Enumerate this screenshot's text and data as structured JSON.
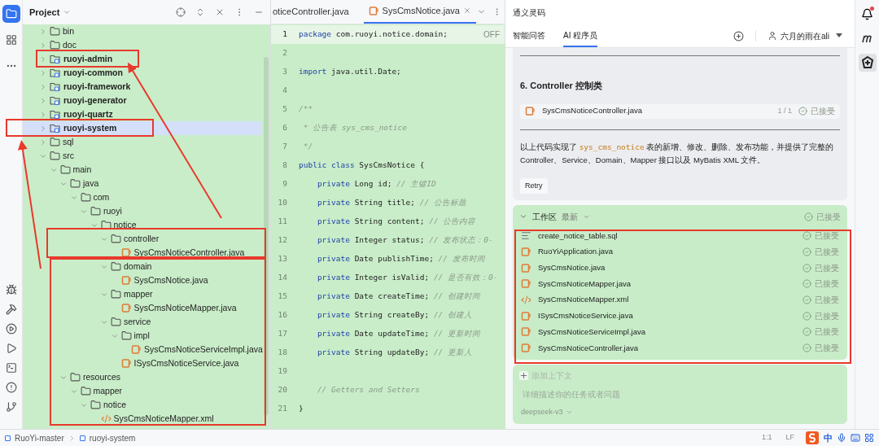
{
  "left_toolbar": {
    "tools": [
      {
        "selected": true
      },
      {
        "selected": false
      },
      {
        "selected": false
      }
    ]
  },
  "project": {
    "title": "Project",
    "tree": [
      {
        "name": "bin",
        "kind": "folder",
        "expanded": false,
        "selected": false
      },
      {
        "name": "doc",
        "kind": "folder",
        "expanded": false,
        "selected": false
      },
      {
        "name": "ruoyi-admin",
        "kind": "module",
        "expanded": false,
        "selected": false
      },
      {
        "name": "ruoyi-common",
        "kind": "module",
        "expanded": false,
        "selected": false
      },
      {
        "name": "ruoyi-framework",
        "kind": "module",
        "expanded": false,
        "selected": false
      },
      {
        "name": "ruoyi-generator",
        "kind": "module",
        "expanded": false,
        "selected": false
      },
      {
        "name": "ruoyi-quartz",
        "kind": "module",
        "expanded": false,
        "selected": false
      },
      {
        "name": "ruoyi-system",
        "kind": "module",
        "expanded": false,
        "selected": true
      },
      {
        "name": "sql",
        "kind": "folder",
        "expanded": false,
        "selected": false
      },
      {
        "name": "src",
        "kind": "folder",
        "expanded": true,
        "selected": false,
        "children": [
          {
            "name": "main",
            "kind": "folder",
            "expanded": true,
            "selected": false,
            "children": [
              {
                "name": "java",
                "kind": "folder",
                "expanded": true,
                "selected": false,
                "children": [
                  {
                    "name": "com",
                    "kind": "folder",
                    "expanded": true,
                    "selected": false,
                    "children": [
                      {
                        "name": "ruoyi",
                        "kind": "folder",
                        "expanded": true,
                        "selected": false,
                        "children": [
                          {
                            "name": "notice",
                            "kind": "folder",
                            "expanded": true,
                            "selected": false,
                            "children": [
                              {
                                "name": "controller",
                                "kind": "folder",
                                "expanded": true,
                                "selected": false,
                                "children": [
                                  {
                                    "name": "SysCmsNoticeController.java",
                                    "kind": "java",
                                    "selected": false
                                  }
                                ]
                              },
                              {
                                "name": "domain",
                                "kind": "folder",
                                "expanded": true,
                                "selected": false,
                                "children": [
                                  {
                                    "name": "SysCmsNotice.java",
                                    "kind": "java",
                                    "selected": false
                                  }
                                ]
                              },
                              {
                                "name": "mapper",
                                "kind": "folder",
                                "expanded": true,
                                "selected": false,
                                "children": [
                                  {
                                    "name": "SysCmsNoticeMapper.java",
                                    "kind": "java",
                                    "selected": false
                                  }
                                ]
                              },
                              {
                                "name": "service",
                                "kind": "folder",
                                "expanded": true,
                                "selected": false,
                                "children": [
                                  {
                                    "name": "impl",
                                    "kind": "folder",
                                    "expanded": true,
                                    "selected": false,
                                    "children": [
                                      {
                                        "name": "SysCmsNoticeServiceImpl.java",
                                        "kind": "java",
                                        "selected": false
                                      }
                                    ]
                                  },
                                  {
                                    "name": "ISysCmsNoticeService.java",
                                    "kind": "java",
                                    "selected": false
                                  }
                                ]
                              }
                            ]
                          }
                        ]
                      }
                    ]
                  }
                ]
              },
              {
                "name": "resources",
                "kind": "folder",
                "expanded": true,
                "selected": false,
                "children": [
                  {
                    "name": "mapper",
                    "kind": "folder",
                    "expanded": true,
                    "selected": false,
                    "children": [
                      {
                        "name": "notice",
                        "kind": "folder",
                        "expanded": true,
                        "selected": false,
                        "children": [
                          {
                            "name": "SysCmsNoticeMapper.xml",
                            "kind": "xml",
                            "selected": false
                          }
                        ]
                      }
                    ]
                  }
                ]
              }
            ]
          }
        ]
      }
    ]
  },
  "editor": {
    "tabs": [
      {
        "label": "oticeController.java",
        "kind": "plain",
        "selected": false
      },
      {
        "label": "SysCmsNotice.java",
        "kind": "java",
        "selected": true
      }
    ],
    "inspection": "OFF",
    "lines": [
      {
        "number": "1",
        "current": true,
        "tokens": [
          {
            "kind": "keyword",
            "text": "package"
          },
          {
            "kind": "plain",
            "text": " com.ruoyi.notice.domain;"
          }
        ]
      },
      {
        "number": "2",
        "current": false
      },
      {
        "number": "3",
        "current": false,
        "tokens": [
          {
            "kind": "keyword",
            "text": "import"
          },
          {
            "kind": "plain",
            "text": " java.util.Date;"
          }
        ]
      },
      {
        "number": "4",
        "current": false
      },
      {
        "number": "5",
        "current": false,
        "tokens": [
          {
            "kind": "comment",
            "text": "/**"
          }
        ]
      },
      {
        "number": "6",
        "current": false,
        "tokens": [
          {
            "kind": "comment",
            "text": " * 公告表 sys_cms_notice"
          }
        ]
      },
      {
        "number": "7",
        "current": false,
        "tokens": [
          {
            "kind": "comment",
            "text": " */"
          }
        ]
      },
      {
        "number": "8",
        "current": false,
        "tokens": [
          {
            "kind": "keyword",
            "text": "public class"
          },
          {
            "kind": "plain",
            "text": " SysCmsNotice {"
          }
        ]
      },
      {
        "number": "9",
        "current": false,
        "tokens": [
          {
            "kind": "keyword",
            "text": "    private"
          },
          {
            "kind": "plain",
            "text": " Long id; "
          },
          {
            "kind": "comment",
            "text": "// 主键ID"
          }
        ]
      },
      {
        "number": "10",
        "current": false,
        "tokens": [
          {
            "kind": "keyword",
            "text": "    private"
          },
          {
            "kind": "plain",
            "text": " String title; "
          },
          {
            "kind": "comment",
            "text": "// 公告标题"
          }
        ]
      },
      {
        "number": "11",
        "current": false,
        "tokens": [
          {
            "kind": "keyword",
            "text": "    private"
          },
          {
            "kind": "plain",
            "text": " String content; "
          },
          {
            "kind": "comment",
            "text": "// 公告内容"
          }
        ]
      },
      {
        "number": "12",
        "current": false,
        "tokens": [
          {
            "kind": "keyword",
            "text": "    private"
          },
          {
            "kind": "plain",
            "text": " Integer status; "
          },
          {
            "kind": "comment",
            "text": "// 发布状态：0-"
          }
        ]
      },
      {
        "number": "13",
        "current": false,
        "tokens": [
          {
            "kind": "keyword",
            "text": "    private"
          },
          {
            "kind": "plain",
            "text": " Date publishTime; "
          },
          {
            "kind": "comment",
            "text": "// 发布时间"
          }
        ]
      },
      {
        "number": "14",
        "current": false,
        "tokens": [
          {
            "kind": "keyword",
            "text": "    private"
          },
          {
            "kind": "plain",
            "text": " Integer isValid; "
          },
          {
            "kind": "comment",
            "text": "// 是否有效：0-"
          }
        ]
      },
      {
        "number": "15",
        "current": false,
        "tokens": [
          {
            "kind": "keyword",
            "text": "    private"
          },
          {
            "kind": "plain",
            "text": " Date createTime; "
          },
          {
            "kind": "comment",
            "text": "// 创建时间"
          }
        ]
      },
      {
        "number": "16",
        "current": false,
        "tokens": [
          {
            "kind": "keyword",
            "text": "    private"
          },
          {
            "kind": "plain",
            "text": " String createBy; "
          },
          {
            "kind": "comment",
            "text": "// 创建人"
          }
        ]
      },
      {
        "number": "17",
        "current": false,
        "tokens": [
          {
            "kind": "keyword",
            "text": "    private"
          },
          {
            "kind": "plain",
            "text": " Date updateTime; "
          },
          {
            "kind": "comment",
            "text": "// 更新时间"
          }
        ]
      },
      {
        "number": "18",
        "current": false,
        "tokens": [
          {
            "kind": "keyword",
            "text": "    private"
          },
          {
            "kind": "plain",
            "text": " String updateBy; "
          },
          {
            "kind": "comment",
            "text": "// 更新人"
          }
        ]
      },
      {
        "number": "19",
        "current": false
      },
      {
        "number": "20",
        "current": false,
        "tokens": [
          {
            "kind": "comment",
            "text": "    // Getters and Setters"
          }
        ]
      },
      {
        "number": "21",
        "current": false,
        "tokens": [
          {
            "kind": "plain",
            "text": "}"
          }
        ]
      }
    ]
  },
  "assistant": {
    "title": "通义灵码",
    "tabs": [
      {
        "label": "智能问答",
        "selected": false
      },
      {
        "label": "AI 程序员",
        "selected": true
      }
    ],
    "user": "六月的雨在ali",
    "answer": {
      "heading": "6. Controller 控制类",
      "file": {
        "name": "SysCmsNoticeController.java",
        "count": "1 / 1",
        "status": "已接受"
      },
      "paragraph": [
        {
          "kind": "text",
          "text": "以上代码实现了 "
        },
        {
          "kind": "code",
          "text": "sys_cms_notice"
        },
        {
          "kind": "text",
          "text": " 表的新增、修改、删除、发布功能，并提供了完整的 Controller、Service、Domain、Mapper 接口以及 MyBatis XML 文件。"
        }
      ],
      "retry": "Retry"
    },
    "workspace": {
      "title": "工作区",
      "filter": "最新",
      "status": "已接受",
      "expanded": true,
      "files": [
        {
          "name": "create_notice_table.sql",
          "kind": "sql",
          "status": "已接受"
        },
        {
          "name": "RuoYiApplication.java",
          "kind": "java",
          "status": "已接受"
        },
        {
          "name": "SysCmsNotice.java",
          "kind": "java",
          "status": "已接受"
        },
        {
          "name": "SysCmsNoticeMapper.java",
          "kind": "java",
          "status": "已接受"
        },
        {
          "name": "SysCmsNoticeMapper.xml",
          "kind": "xml",
          "status": "已接受"
        },
        {
          "name": "ISysCmsNoticeService.java",
          "kind": "java",
          "status": "已接受"
        },
        {
          "name": "SysCmsNoticeServiceImpl.java",
          "kind": "java",
          "status": "已接受"
        },
        {
          "name": "SysCmsNoticeController.java",
          "kind": "java",
          "status": "已接受"
        }
      ]
    },
    "input": {
      "add_context": "添加上下文",
      "placeholder": "详细描述你的任务或者问题",
      "model": "deepseek-v3"
    }
  },
  "right_toolbar": {
    "tools": [
      {
        "selected": false,
        "badge": true
      },
      {
        "selected": false,
        "badge": false
      },
      {
        "selected": true,
        "badge": false
      }
    ]
  },
  "status_bar": {
    "breadcrumbs": [
      "RuoYi-master",
      "ruoyi-system"
    ],
    "position": "1:1",
    "line_ending": "LF",
    "ime": "中"
  }
}
